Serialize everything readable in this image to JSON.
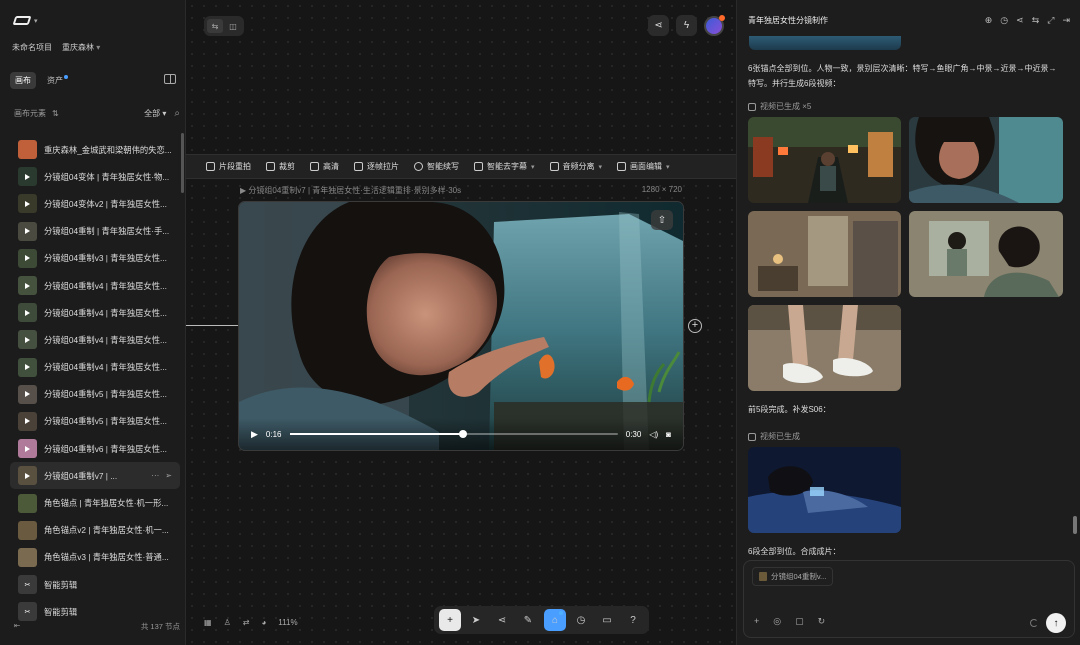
{
  "left": {
    "project": "未命名项目",
    "folder": "重庆森林",
    "tabs": [
      "画布",
      "资产"
    ],
    "elements_label": "画布元素",
    "filter": "全部",
    "items": [
      {
        "label": "重庆森林_金城武和梁朝伟的失恋...",
        "kind": "photo",
        "color": "#c0603a"
      },
      {
        "label": "分镜组04变体 | 青年独居女性·物...",
        "kind": "video",
        "color": "#2a3a2e"
      },
      {
        "label": "分镜组04变体v2 | 青年独居女性...",
        "kind": "video",
        "color": "#3a3a2a"
      },
      {
        "label": "分镜组04重制 | 青年独居女性·手...",
        "kind": "video",
        "color": "#4a4a40"
      },
      {
        "label": "分镜组04重制v3 | 青年独居女性...",
        "kind": "video",
        "color": "#3c4a36"
      },
      {
        "label": "分镜组04重制v4 | 青年独居女性...",
        "kind": "video",
        "color": "#44523e"
      },
      {
        "label": "分镜组04重制v4 | 青年独居女性...",
        "kind": "video",
        "color": "#3e4a3a"
      },
      {
        "label": "分镜组04重制v4 | 青年独居女性...",
        "kind": "video",
        "color": "#465040"
      },
      {
        "label": "分镜组04重制v4 | 青年独居女性...",
        "kind": "video",
        "color": "#40503c"
      },
      {
        "label": "分镜组04重制v5 | 青年独居女性...",
        "kind": "video",
        "color": "#57504a"
      },
      {
        "label": "分镜组04重制v5 | 青年独居女性...",
        "kind": "video",
        "color": "#4a4238"
      },
      {
        "label": "分镜组04重制v6 | 青年独居女性...",
        "kind": "video",
        "color": "#b07a9a"
      },
      {
        "label": "分镜组04重制v7 | ...",
        "kind": "video",
        "color": "#5a5040",
        "selected": true
      },
      {
        "label": "角色锚点 | 青年独居女性·机一形...",
        "kind": "photo",
        "color": "#4c5a3a"
      },
      {
        "label": "角色锚点v2 | 青年独居女性·机一...",
        "kind": "photo",
        "color": "#6a5a40"
      },
      {
        "label": "角色锚点v3 | 青年独居女性·普通...",
        "kind": "photo",
        "color": "#7a6a50"
      },
      {
        "label": "智能剪辑",
        "kind": "tool",
        "color": "#3a3a3a"
      },
      {
        "label": "智能剪辑",
        "kind": "tool",
        "color": "#3a3a3a"
      }
    ],
    "footer_count": "共 137 节点"
  },
  "toolbar": [
    {
      "label": "片段重拍",
      "shape": "sq"
    },
    {
      "label": "裁剪",
      "shape": "sq"
    },
    {
      "label": "高清",
      "shape": "sq"
    },
    {
      "label": "逐帧拉片",
      "shape": "sq"
    },
    {
      "label": "智能续写",
      "shape": "c"
    },
    {
      "label": "智能去字幕",
      "shape": "sq",
      "dropdown": true
    },
    {
      "label": "音频分离",
      "shape": "sq",
      "dropdown": true
    },
    {
      "label": "画面编辑",
      "shape": "sq",
      "dropdown": true
    }
  ],
  "clip": {
    "title": "▶ 分镜组04重制v7 | 青年独居女性·生活逻辑重排·景别多样·30s",
    "resolution": "1280 × 720",
    "current": "0:16",
    "duration": "0:30",
    "progress": 0.53
  },
  "zoom": "111%",
  "right": {
    "title": "青年独居女性分镜制作",
    "msg1": "6张锚点全部到位。人物一致，景别层次清晰：特写→鱼眼广角→中景→近景→中近景→特写。并行生成6段视频：",
    "gen1": "视频已生成 ×5",
    "msg2": "前5段完成。补发S06：",
    "gen2": "视频已生成",
    "msg3": "6段全部到位。合成成片：",
    "chip": "分镜组04重制v..."
  },
  "colors": {
    "accent": "#4a9eff",
    "notify": "#ff6a2b"
  }
}
